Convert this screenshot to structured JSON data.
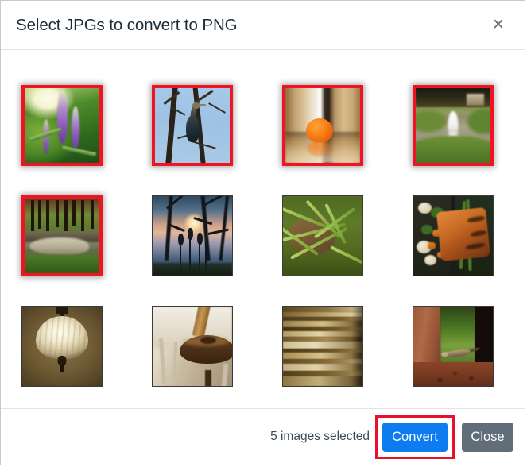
{
  "dialog": {
    "title": "Select JPGs to convert to PNG",
    "close_icon": "close-icon",
    "close_glyph": "✕"
  },
  "colors": {
    "selection_border": "#f01423",
    "highlight_annotation": "#e8112d",
    "primary_button": "#0c7cf0",
    "secondary_button": "#616d78",
    "title_text": "#1d2b36",
    "divider": "#e3e3e6"
  },
  "grid": {
    "columns": 4,
    "rows": 3,
    "thumbnails": [
      {
        "index": 1,
        "label": "purple-flower-spikes",
        "selected": true
      },
      {
        "index": 2,
        "label": "cormorant-bird-in-bare-tree",
        "selected": true
      },
      {
        "index": 3,
        "label": "orange-fruit-on-table",
        "selected": true
      },
      {
        "index": 4,
        "label": "pond-fountain-in-park",
        "selected": true
      },
      {
        "index": 5,
        "label": "forest-stream-clearing",
        "selected": true
      },
      {
        "index": 6,
        "label": "sunset-through-trees-with-reeds",
        "selected": false
      },
      {
        "index": 7,
        "label": "green-grass-closeup",
        "selected": false
      },
      {
        "index": 8,
        "label": "grilled-salmon-with-vegetables",
        "selected": false
      },
      {
        "index": 9,
        "label": "ceiling-lamp-shade",
        "selected": false
      },
      {
        "index": 10,
        "label": "wooden-stool-detail",
        "selected": false
      },
      {
        "index": 11,
        "label": "stacked-book-page-edges",
        "selected": false
      },
      {
        "index": 12,
        "label": "lizard-on-red-stone",
        "selected": false
      }
    ]
  },
  "footer": {
    "selection_count": "5 images selected",
    "convert_label": "Convert",
    "close_label": "Close"
  }
}
